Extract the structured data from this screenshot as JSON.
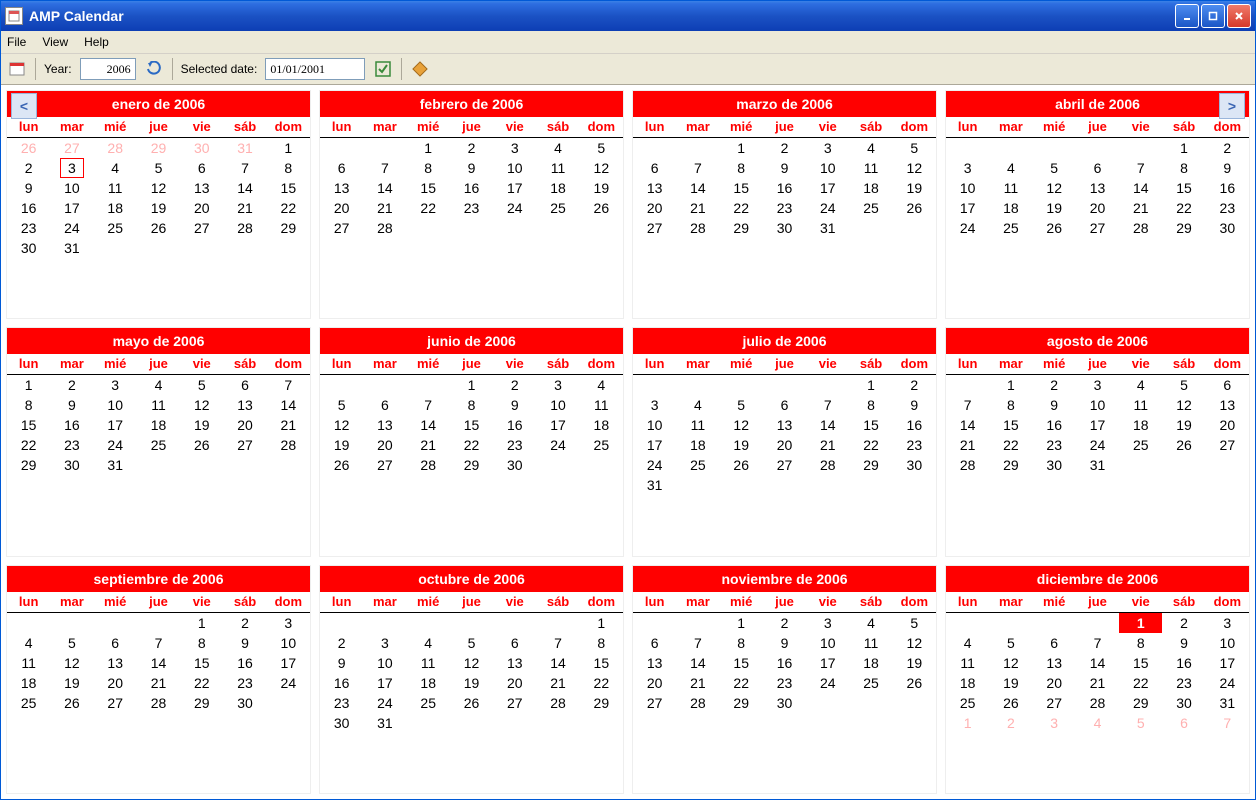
{
  "window": {
    "title": "AMP Calendar"
  },
  "menu": {
    "file": "File",
    "view": "View",
    "help": "Help"
  },
  "toolbar": {
    "year_label": "Year:",
    "year_value": "2006",
    "selected_label": "Selected date:",
    "selected_value": "01/01/2001"
  },
  "nav": {
    "prev": "<",
    "next": ">"
  },
  "dow": [
    "lun",
    "mar",
    "mié",
    "jue",
    "vie",
    "sáb",
    "dom"
  ],
  "months": [
    {
      "title": "enero de 2006",
      "lead": 0,
      "leadStart": 26,
      "leadCount": 6,
      "days": 31,
      "trail": 0,
      "today": null,
      "boxed": 3
    },
    {
      "title": "febrero de 2006",
      "lead": 2,
      "leadStart": 0,
      "leadCount": 0,
      "days": 28,
      "trail": 0,
      "today": null,
      "boxed": null
    },
    {
      "title": "marzo de 2006",
      "lead": 2,
      "leadStart": 0,
      "leadCount": 0,
      "days": 31,
      "trail": 0,
      "today": null,
      "boxed": null
    },
    {
      "title": "abril de 2006",
      "lead": 5,
      "leadStart": 0,
      "leadCount": 0,
      "days": 30,
      "trail": 0,
      "today": null,
      "boxed": null
    },
    {
      "title": "mayo de 2006",
      "lead": 0,
      "leadStart": 0,
      "leadCount": 0,
      "days": 31,
      "trail": 0,
      "today": null,
      "boxed": null
    },
    {
      "title": "junio de 2006",
      "lead": 3,
      "leadStart": 0,
      "leadCount": 0,
      "days": 30,
      "trail": 0,
      "today": null,
      "boxed": null
    },
    {
      "title": "julio de 2006",
      "lead": 5,
      "leadStart": 0,
      "leadCount": 0,
      "days": 31,
      "trail": 0,
      "today": null,
      "boxed": null
    },
    {
      "title": "agosto de 2006",
      "lead": 1,
      "leadStart": 0,
      "leadCount": 0,
      "days": 31,
      "trail": 0,
      "today": null,
      "boxed": null
    },
    {
      "title": "septiembre de 2006",
      "lead": 4,
      "leadStart": 0,
      "leadCount": 0,
      "days": 30,
      "trail": 0,
      "today": null,
      "boxed": null
    },
    {
      "title": "octubre de 2006",
      "lead": 6,
      "leadStart": 0,
      "leadCount": 0,
      "days": 31,
      "trail": 0,
      "today": null,
      "boxed": null
    },
    {
      "title": "noviembre de 2006",
      "lead": 2,
      "leadStart": 0,
      "leadCount": 0,
      "days": 30,
      "trail": 0,
      "today": null,
      "boxed": null
    },
    {
      "title": "diciembre de 2006",
      "lead": 4,
      "leadStart": 0,
      "leadCount": 0,
      "days": 31,
      "trail": 7,
      "today": 1,
      "boxed": null
    }
  ]
}
